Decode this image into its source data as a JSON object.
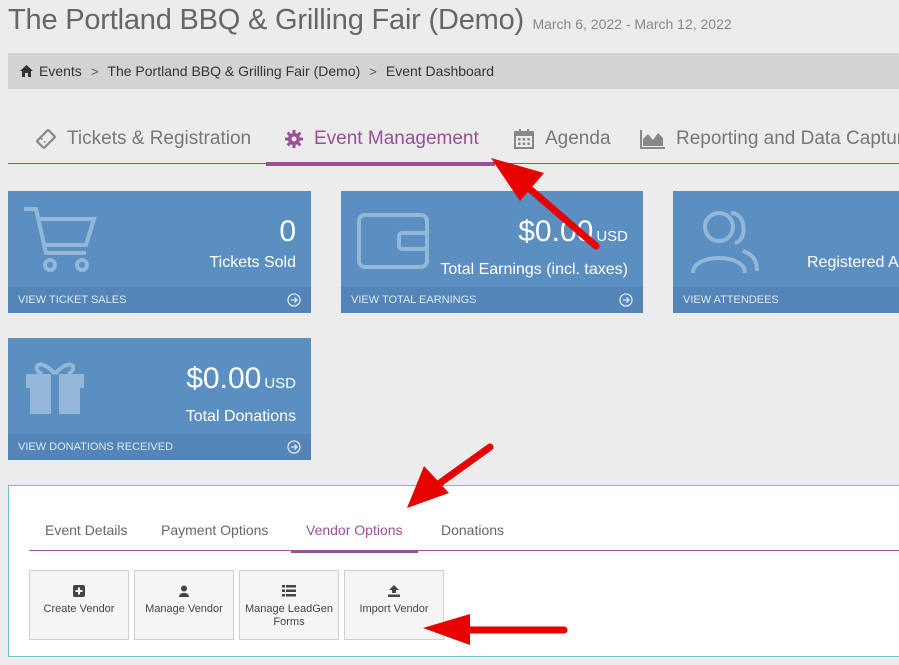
{
  "header": {
    "title": "The Portland BBQ & Grilling Fair (Demo)",
    "dates": "March 6, 2022 - March 12, 2022"
  },
  "breadcrumb": {
    "items": [
      "Events",
      "The Portland BBQ & Grilling Fair (Demo)",
      "Event Dashboard"
    ],
    "separator": ">"
  },
  "main_tabs": [
    {
      "label": "Tickets & Registration",
      "icon": "ticket-icon"
    },
    {
      "label": "Event Management",
      "icon": "gear-icon",
      "active": true
    },
    {
      "label": "Agenda",
      "icon": "calendar-icon"
    },
    {
      "label": "Reporting and Data Capture",
      "icon": "area-chart-icon"
    }
  ],
  "tiles": {
    "tickets": {
      "value": "0",
      "label": "Tickets Sold",
      "link": "VIEW TICKET SALES",
      "icon": "cart-icon"
    },
    "earnings": {
      "value": "$0.00",
      "unit": "USD",
      "label": "Total Earnings (incl. taxes)",
      "link": "VIEW TOTAL EARNINGS",
      "icon": "wallet-icon"
    },
    "attendees": {
      "label": "Registered Attendees",
      "link": "VIEW ATTENDEES",
      "icon": "users-icon"
    },
    "donations": {
      "value": "$0.00",
      "unit": "USD",
      "label": "Total Donations",
      "link": "VIEW DONATIONS RECEIVED",
      "icon": "gift-icon"
    }
  },
  "sub_tabs": [
    {
      "label": "Event Details"
    },
    {
      "label": "Payment Options"
    },
    {
      "label": "Vendor Options",
      "active": true
    },
    {
      "label": "Donations"
    }
  ],
  "actions": [
    {
      "label": "Create Vendor",
      "icon": "plus-square-icon"
    },
    {
      "label": "Manage Vendor",
      "icon": "user-icon"
    },
    {
      "label": "Manage LeadGen Forms",
      "icon": "list-icon"
    },
    {
      "label": "Import Vendor",
      "icon": "upload-icon"
    }
  ],
  "colors": {
    "accent": "#9b4f96",
    "tile": "#5b8fc2",
    "annotation_arrow": "#e60000"
  }
}
